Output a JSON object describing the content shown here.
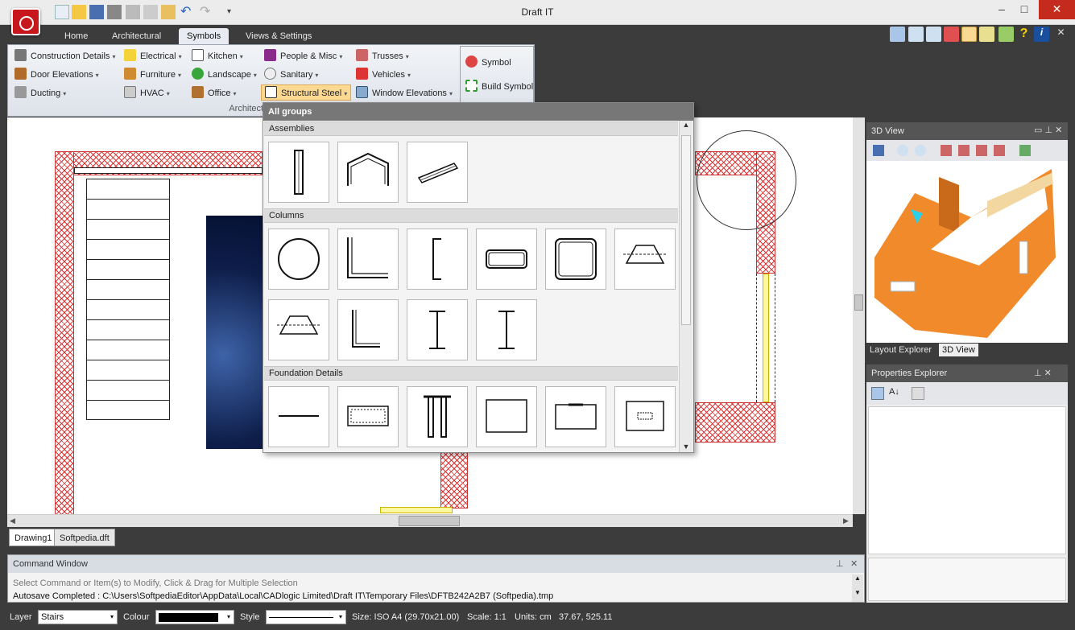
{
  "window": {
    "title": "Draft IT"
  },
  "tabs": [
    {
      "label": "Home"
    },
    {
      "label": "Architectural"
    },
    {
      "label": "Symbols"
    },
    {
      "label": "Views & Settings"
    }
  ],
  "ribbon": {
    "group_label": "Architectural Symbols",
    "col1": [
      "Construction Details",
      "Door Elevations",
      "Ducting"
    ],
    "col2": [
      "Electrical",
      "Furniture",
      "HVAC"
    ],
    "col3": [
      "Kitchen",
      "Landscape",
      "Office"
    ],
    "col4": [
      "People & Misc",
      "Sanitary",
      "Structural Steel"
    ],
    "col5": [
      "Trusses",
      "Vehicles",
      "Window Elevations"
    ],
    "symbol_label": "Symbol",
    "build_symbol_label": "Build Symbol"
  },
  "dropdown": {
    "header": "All groups",
    "sections": [
      "Assemblies",
      "Columns",
      "Foundation Details"
    ]
  },
  "document_tabs": [
    "Drawing1",
    "Softpedia.dft"
  ],
  "command_window": {
    "title": "Command Window",
    "prompt": "Select Command or Item(s) to Modify, Click & Drag for Multiple Selection",
    "log": "Autosave Completed : C:\\Users\\SoftpediaEditor\\AppData\\Local\\CADlogic Limited\\Draft IT\\Temporary Files\\DFTB242A2B7 (Softpedia).tmp"
  },
  "right_panels": {
    "view3d_title": "3D View",
    "tab_layout_explorer": "Layout Explorer",
    "tab_3d_view": "3D View",
    "properties_title": "Properties Explorer"
  },
  "status": {
    "layer_label": "Layer",
    "layer_value": "Stairs",
    "colour_label": "Colour",
    "style_label": "Style",
    "size": "Size: ISO A4 (29.70x21.00)",
    "scale": "Scale: 1:1",
    "units": "Units: cm",
    "coords": "37.67, 525.11"
  },
  "colors": {
    "accent": "#fcd992",
    "wall": "#d33333",
    "app_button": "#c8161d",
    "model3d": "#f08a2a"
  }
}
